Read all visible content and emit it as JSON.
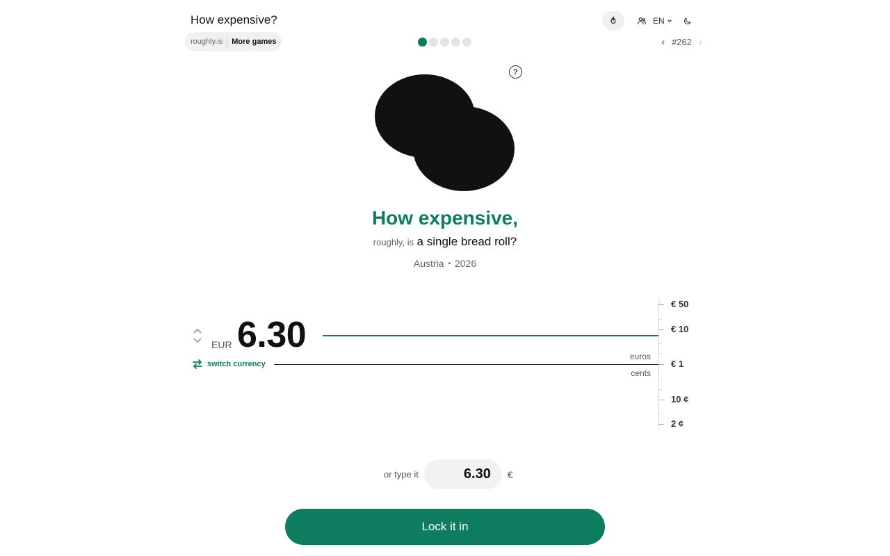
{
  "header": {
    "title": "How expensive?",
    "site": "roughly.is",
    "more_games": "More games",
    "language": "EN",
    "puzzle_number": "#262",
    "prev_glyph": "‹",
    "next_glyph": "›",
    "progress": {
      "total": 5,
      "current": 1
    }
  },
  "question": {
    "heading": "How expensive,",
    "prefix": "roughly, is",
    "subject": "a single bread roll?",
    "country": "Austria",
    "year": "2026",
    "help_label": "?"
  },
  "guess": {
    "currency_code": "EUR",
    "value": "6.30",
    "switch_currency_label": "switch currency",
    "upper_unit": "euros",
    "lower_unit": "cents"
  },
  "scale": {
    "labels": [
      {
        "text": "€ 50",
        "value": 50
      },
      {
        "text": "€ 10",
        "value": 10
      },
      {
        "text": "€ 1",
        "value": 1
      },
      {
        "text": "10 ¢",
        "value": 0.1
      },
      {
        "text": "2 ¢",
        "value": 0.02
      }
    ]
  },
  "input": {
    "label": "or type it",
    "value": "6.30",
    "suffix": "€"
  },
  "actions": {
    "lock_label": "Lock it in"
  },
  "colors": {
    "accent": "#0e7c5e",
    "image": "#111111"
  },
  "icons": {
    "streak": "flame-icon",
    "friends": "friends-icon",
    "dark_mode": "moon-icon",
    "switch": "swap-arrows-icon",
    "stepper_up": "chevron-up-icon",
    "stepper_down": "chevron-down-icon"
  }
}
